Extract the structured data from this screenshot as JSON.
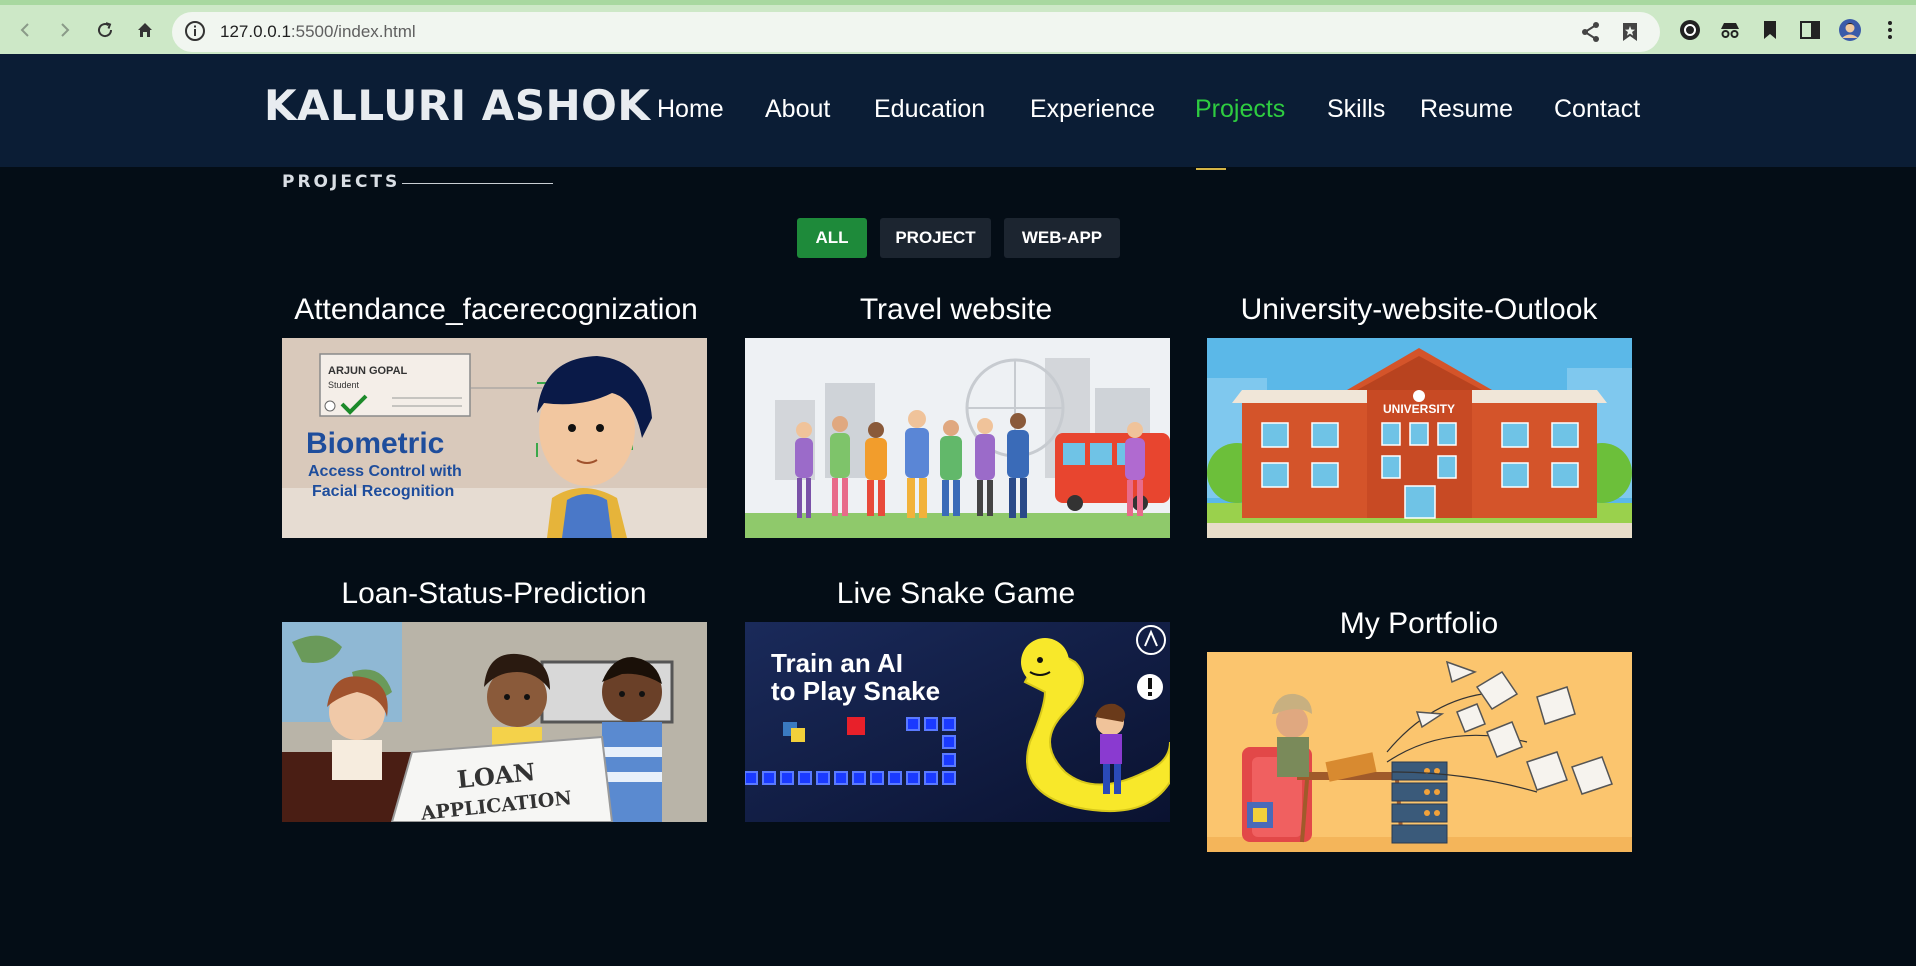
{
  "browser": {
    "url_host": "127.0.0.1",
    "url_path": ":5500/index.html"
  },
  "site": {
    "brand": "KALLURI ASHOK",
    "nav": [
      {
        "label": "Home"
      },
      {
        "label": "About"
      },
      {
        "label": "Education"
      },
      {
        "label": "Experience"
      },
      {
        "label": "Projects",
        "active": true
      },
      {
        "label": "Skills"
      },
      {
        "label": "Resume"
      },
      {
        "label": "Contact"
      }
    ]
  },
  "projects_section": {
    "label": "PROJECTS",
    "filters": [
      {
        "label": "ALL",
        "active": true
      },
      {
        "label": "PROJECT"
      },
      {
        "label": "WEB-APP"
      }
    ],
    "cards": [
      {
        "title": "Attendance_facerecognization",
        "image": {
          "name": "ARJUN GOPAL",
          "role": "Student",
          "headline": "Biometric",
          "sub1": "Access Control with",
          "sub2": "Facial Recognition"
        }
      },
      {
        "title": "Travel website"
      },
      {
        "title": "University-website-Outlook",
        "image": {
          "sign": "UNIVERSITY"
        }
      },
      {
        "title": "Loan-Status-Prediction",
        "image": {
          "sign1": "LOAN",
          "sign2": "APPLICATION"
        }
      },
      {
        "title": "Live Snake Game",
        "image": {
          "line1": "Train an AI",
          "line2": "to Play Snake"
        }
      },
      {
        "title": "My Portfolio"
      }
    ]
  },
  "colors": {
    "accent": "#2ecc40",
    "header_bg": "#0b1d35",
    "page_bg": "#040d16",
    "filter_active": "#1e8a3a"
  }
}
